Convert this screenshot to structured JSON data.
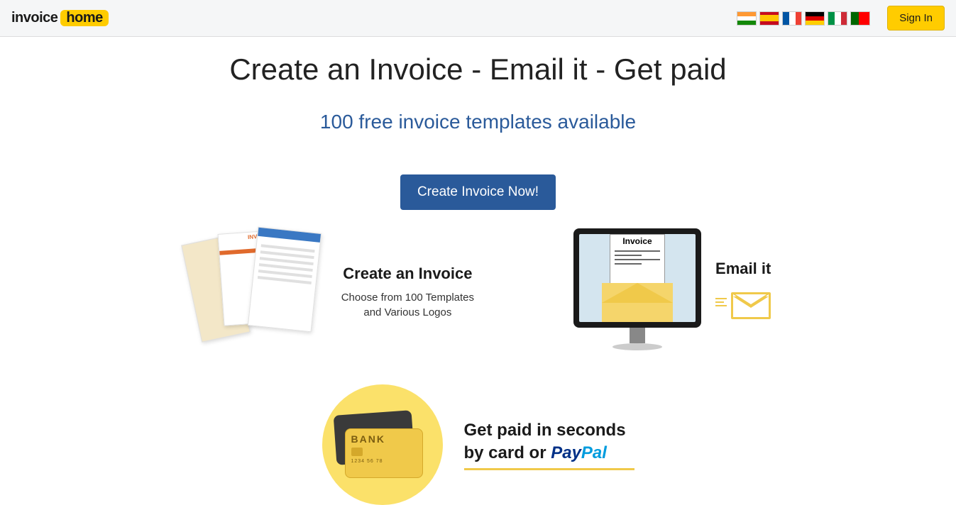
{
  "header": {
    "logo_part1": "invoice",
    "logo_part2": "home",
    "signin": "Sign In",
    "flags": [
      "india",
      "spain",
      "france",
      "germany",
      "italy",
      "portugal"
    ]
  },
  "hero": {
    "title": "Create an Invoice - Email it - Get paid",
    "subtitle": "100 free invoice templates available",
    "cta": "Create Invoice Now!"
  },
  "feature1": {
    "title": "Create an Invoice",
    "desc_line1": "Choose from 100 Templates",
    "desc_line2": "and Various Logos",
    "sheet_label": "INVOICE"
  },
  "feature2": {
    "title": "Email it",
    "doc_label": "Invoice"
  },
  "feature3": {
    "line1": "Get paid in seconds",
    "line2_prefix": "by card or ",
    "paypal_pay": "Pay",
    "paypal_pal": "Pal",
    "bank_label": "BANK"
  }
}
